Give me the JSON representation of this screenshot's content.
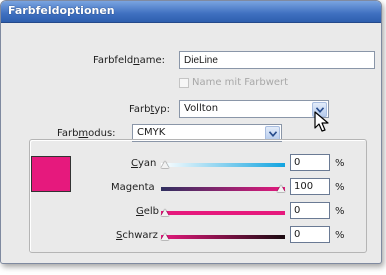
{
  "dialog": {
    "title": "Farbfeldoptionen"
  },
  "swatch_name": {
    "label_pre": "Farbfeld",
    "label_u": "n",
    "label_post": "ame:",
    "value": "DieLine"
  },
  "name_with_value": {
    "label": "Name mit Farbwert",
    "checked": false,
    "enabled": false
  },
  "color_type": {
    "label_pre": "Farb",
    "label_u": "t",
    "label_post": "yp:",
    "value": "Vollton"
  },
  "color_mode": {
    "label_pre": "Farb",
    "label_u": "m",
    "label_post": "odus:",
    "value": "CMYK"
  },
  "swatch_color": "#e6197d",
  "channels": [
    {
      "label_u": "C",
      "label_rest": "yan",
      "value": "0",
      "unit": "%"
    },
    {
      "label_u": "",
      "label_rest": "Magenta",
      "value": "100",
      "unit": "%"
    },
    {
      "label_u": "G",
      "label_rest": "elb",
      "value": "0",
      "unit": "%"
    },
    {
      "label_u": "S",
      "label_rest": "chwarz",
      "value": "0",
      "unit": "%"
    }
  ],
  "channel_levels": [
    0,
    100,
    0,
    0
  ],
  "icons": {
    "dropdown": "chevron-down-icon",
    "cursor": "mouse-pointer-icon"
  }
}
